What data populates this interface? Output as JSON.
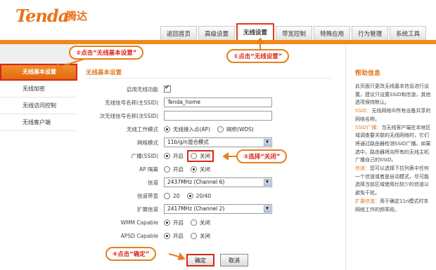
{
  "brand": {
    "logo": "Tenda",
    "logo_cn": "腾达"
  },
  "nav": {
    "tabs": [
      "返回首页",
      "高级设置",
      "无线设置",
      "带宽控制",
      "特殊应用",
      "行为管理",
      "系统工具"
    ],
    "active": "无线设置"
  },
  "sidebar": {
    "items": [
      "无线基本设置",
      "无线加密",
      "无线访问控制",
      "无线客户端"
    ]
  },
  "main": {
    "title": "无线基本设置",
    "enable_label": "启用无线功能",
    "ssid_main_label": "无线信号名称(主SSID)",
    "ssid_main_value": "Tenda_home",
    "ssid_sub_label": "次无线信号名称(次SSID)",
    "ssid_sub_value": "",
    "mode_label": "无线工作模式",
    "mode_opt1": "无线接入点(AP)",
    "mode_opt2": "网桥(WDS)",
    "net_mode_label": "网络模式",
    "net_mode_value": "11b/g/n混合模式",
    "broadcast_label": "广播(SSID)",
    "broadcast_on": "开启",
    "broadcast_off": "关闭",
    "ap_isolation_label": "AP 隔离",
    "ap_isolation_on": "开启",
    "ap_isolation_off": "关闭",
    "channel_label": "信道",
    "channel_value": "2437MHz (Channel 6)",
    "bandwidth_label": "信道带宽",
    "bandwidth_opt1": "20",
    "bandwidth_opt2": "20/40",
    "ext_channel_label": "扩展信道",
    "ext_channel_value": "2417MHz (Channel 2)",
    "wmm_label": "WMM Capable",
    "wmm_on": "开启",
    "wmm_off": "关闭",
    "apsd_label": "APSD Capable",
    "apsd_on": "开启",
    "apsd_off": "关闭",
    "ok_button": "确定",
    "cancel_button": "取消"
  },
  "help": {
    "title": "帮助信息",
    "p1": "此页面只更改无线基本信息进行设置，建议只设置SSID和信道，其他选项保持默认。",
    "ssid_term": "SSID：",
    "ssid_text": "无线网络中所有设备共享的网络名称。",
    "bcast_term": "SSID广播：",
    "bcast_text": "当无线客户端在本地区域调查要关联的无线网络时，它们将通过路由器检测SSID广播。如果选中，路由器将向所有的无线主机广播自己的SSID。",
    "channel_term": "信道：",
    "channel_text": "您可以选择下拉列表中任何一个信道或者是自动模式，尽可能选择当前区域使用比较少的信道以避免干扰。",
    "ext_term": "扩展信道：",
    "ext_text": "用于确定11n模式时本网络工作的频率段。"
  },
  "callouts": {
    "c1": "①点击“无线设置”",
    "c2": "②点击“无线基本设置”",
    "c3": "③选择“关闭”",
    "c4": "④点击“确定”"
  },
  "colors": {
    "accent": "#f08a1c",
    "highlight": "#d9261c",
    "help_title": "#e07a20"
  }
}
